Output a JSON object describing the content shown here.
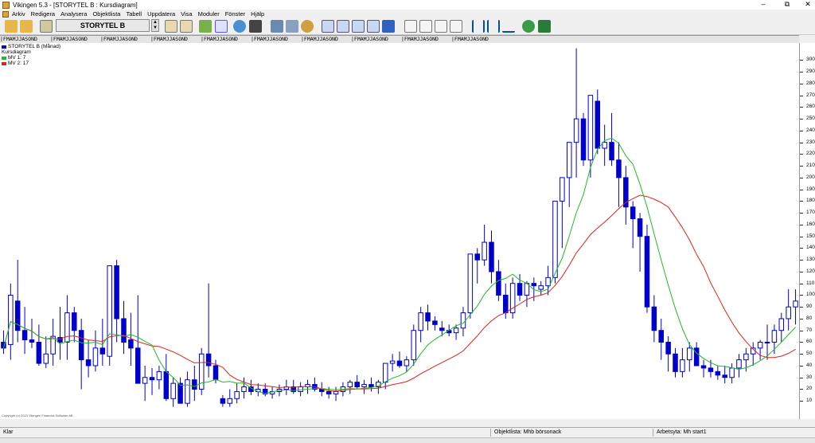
{
  "window": {
    "title": "Vikingen 5.3 - [STORYTEL B : Kursdiagram]",
    "minimize": "–",
    "maximize": "⧉",
    "close": "✕"
  },
  "menu": [
    "Arkiv",
    "Redigera",
    "Analysera",
    "Objektlista",
    "Tabell",
    "Uppdatera",
    "Visa",
    "Moduler",
    "Fönster",
    "Hjälp"
  ],
  "toolbar": {
    "symbol": "STORYTEL B"
  },
  "month_strip": "FMAMJJASOND",
  "legend": {
    "instrument": "STORYTEL B (Månad)",
    "diagram": "Kursdiagram",
    "ma1": "MV 1: 7",
    "ma2": "MV 2: 17"
  },
  "copyright": "Copyright (c) 2023 Vikingen Financial Software AB",
  "colors": {
    "candle": "#0000cc",
    "ma1": "#22bb22",
    "ma2": "#dd2222"
  },
  "status": {
    "left": "Klar",
    "mid": "Objektlista: Mhb börsonack",
    "right": "Arbetsyta: Mh start1"
  },
  "chart_data": {
    "type": "candlestick",
    "ylim": [
      0,
      305
    ],
    "yticks": [
      10,
      20,
      30,
      40,
      50,
      60,
      70,
      80,
      90,
      100,
      110,
      120,
      130,
      140,
      150,
      160,
      170,
      180,
      190,
      200,
      210,
      220,
      230,
      240,
      250,
      260,
      270,
      280,
      290,
      300
    ],
    "ohlc": [
      [
        60,
        70,
        50,
        55
      ],
      [
        58,
        110,
        45,
        100
      ],
      [
        95,
        130,
        60,
        70
      ],
      [
        70,
        90,
        50,
        62
      ],
      [
        62,
        80,
        55,
        60
      ],
      [
        60,
        75,
        40,
        42
      ],
      [
        42,
        65,
        38,
        50
      ],
      [
        50,
        80,
        40,
        65
      ],
      [
        64,
        90,
        45,
        60
      ],
      [
        60,
        100,
        45,
        85
      ],
      [
        85,
        90,
        60,
        70
      ],
      [
        70,
        80,
        20,
        45
      ],
      [
        45,
        62,
        30,
        40
      ],
      [
        40,
        70,
        35,
        55
      ],
      [
        55,
        80,
        40,
        50
      ],
      [
        48,
        125,
        40,
        125
      ],
      [
        125,
        130,
        60,
        80
      ],
      [
        80,
        95,
        50,
        60
      ],
      [
        62,
        85,
        40,
        55
      ],
      [
        55,
        100,
        30,
        25
      ],
      [
        25,
        40,
        10,
        30
      ],
      [
        30,
        38,
        15,
        28
      ],
      [
        28,
        40,
        20,
        35
      ],
      [
        35,
        50,
        10,
        12
      ],
      [
        12,
        30,
        5,
        25
      ],
      [
        25,
        30,
        8,
        8
      ],
      [
        8,
        35,
        5,
        28
      ],
      [
        28,
        40,
        10,
        20
      ],
      [
        20,
        55,
        15,
        50
      ],
      [
        50,
        110,
        30,
        40
      ],
      [
        40,
        45,
        25,
        28
      ],
      [
        12,
        15,
        5,
        8
      ],
      [
        8,
        20,
        5,
        12
      ],
      [
        12,
        25,
        8,
        18
      ],
      [
        18,
        30,
        12,
        22
      ],
      [
        22,
        28,
        15,
        18
      ],
      [
        18,
        25,
        14,
        20
      ],
      [
        20,
        25,
        14,
        16
      ],
      [
        16,
        22,
        12,
        18
      ],
      [
        18,
        24,
        14,
        20
      ],
      [
        20,
        28,
        15,
        22
      ],
      [
        22,
        28,
        16,
        18
      ],
      [
        18,
        26,
        14,
        22
      ],
      [
        22,
        28,
        16,
        24
      ],
      [
        24,
        30,
        18,
        20
      ],
      [
        20,
        26,
        14,
        18
      ],
      [
        18,
        22,
        12,
        16
      ],
      [
        16,
        22,
        10,
        18
      ],
      [
        18,
        26,
        14,
        22
      ],
      [
        22,
        28,
        16,
        26
      ],
      [
        26,
        32,
        20,
        22
      ],
      [
        22,
        28,
        16,
        24
      ],
      [
        24,
        30,
        18,
        22
      ],
      [
        22,
        28,
        16,
        26
      ],
      [
        26,
        38,
        20,
        42
      ],
      [
        42,
        50,
        35,
        44
      ],
      [
        44,
        52,
        38,
        40
      ],
      [
        40,
        48,
        35,
        45
      ],
      [
        45,
        75,
        40,
        70
      ],
      [
        70,
        90,
        60,
        85
      ],
      [
        85,
        92,
        70,
        78
      ],
      [
        78,
        82,
        70,
        75
      ],
      [
        72,
        78,
        65,
        70
      ],
      [
        70,
        75,
        65,
        68
      ],
      [
        68,
        75,
        62,
        72
      ],
      [
        72,
        90,
        65,
        85
      ],
      [
        85,
        130,
        80,
        135
      ],
      [
        135,
        140,
        110,
        130
      ],
      [
        130,
        160,
        125,
        145
      ],
      [
        145,
        155,
        110,
        120
      ],
      [
        120,
        130,
        95,
        100
      ],
      [
        100,
        110,
        80,
        85
      ],
      [
        85,
        115,
        80,
        110
      ],
      [
        110,
        118,
        95,
        100
      ],
      [
        100,
        112,
        90,
        110
      ],
      [
        110,
        115,
        95,
        108
      ],
      [
        105,
        112,
        100,
        108
      ],
      [
        108,
        125,
        100,
        115
      ],
      [
        115,
        160,
        110,
        180
      ],
      [
        180,
        200,
        140,
        200
      ],
      [
        200,
        215,
        175,
        230
      ],
      [
        230,
        310,
        200,
        250
      ],
      [
        250,
        255,
        210,
        215
      ],
      [
        215,
        230,
        200,
        270
      ],
      [
        265,
        275,
        220,
        225
      ],
      [
        225,
        245,
        210,
        230
      ],
      [
        230,
        255,
        210,
        215
      ],
      [
        215,
        230,
        175,
        200
      ],
      [
        200,
        210,
        160,
        175
      ],
      [
        175,
        180,
        140,
        165
      ],
      [
        165,
        170,
        120,
        150
      ],
      [
        150,
        160,
        85,
        90
      ],
      [
        90,
        100,
        60,
        70
      ],
      [
        70,
        80,
        45,
        60
      ],
      [
        60,
        65,
        35,
        50
      ],
      [
        50,
        55,
        30,
        35
      ],
      [
        35,
        55,
        30,
        45
      ],
      [
        45,
        60,
        35,
        55
      ],
      [
        55,
        60,
        40,
        40
      ],
      [
        40,
        45,
        30,
        38
      ],
      [
        38,
        45,
        30,
        35
      ],
      [
        35,
        40,
        28,
        32
      ],
      [
        32,
        40,
        25,
        30
      ],
      [
        30,
        42,
        25,
        38
      ],
      [
        38,
        50,
        30,
        45
      ],
      [
        45,
        55,
        35,
        50
      ],
      [
        50,
        60,
        40,
        55
      ],
      [
        55,
        62,
        45,
        60
      ],
      [
        60,
        75,
        45,
        60
      ],
      [
        60,
        75,
        50,
        70
      ],
      [
        70,
        85,
        60,
        80
      ],
      [
        80,
        105,
        70,
        90
      ],
      [
        90,
        105,
        75,
        95
      ]
    ]
  }
}
